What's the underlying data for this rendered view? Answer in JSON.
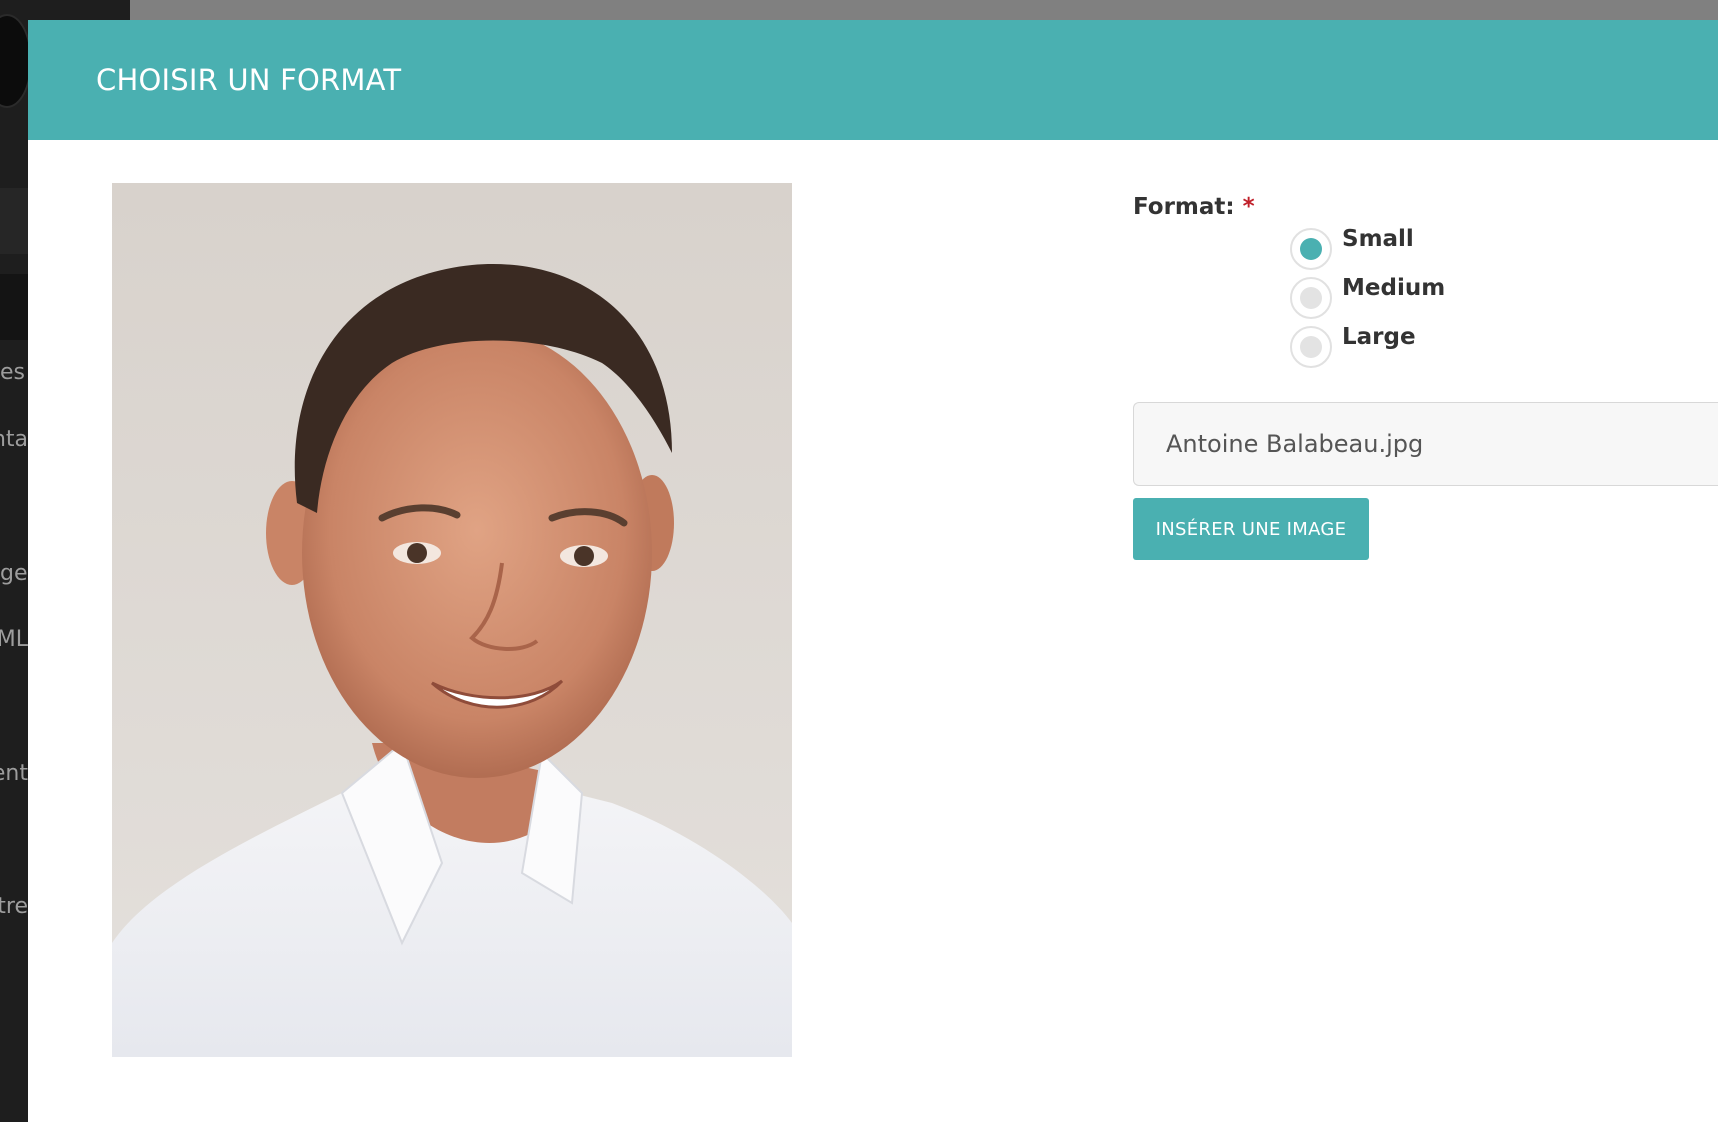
{
  "backdrop": {
    "sidebar_labels": [
      "es",
      "nta",
      "ge",
      "ML",
      "ent",
      "tre"
    ]
  },
  "modal": {
    "title": "CHOISIR UN FORMAT",
    "header_color": "#4ab0b1"
  },
  "preview": {
    "alt": "Antoine Balabeau.jpg"
  },
  "form": {
    "format_label": "Format:",
    "required_mark": "*",
    "options": [
      {
        "label": "Small",
        "checked": true
      },
      {
        "label": "Medium",
        "checked": false
      },
      {
        "label": "Large",
        "checked": false
      }
    ],
    "filename_value": "Antoine Balabeau.jpg",
    "insert_button_label": "INSÉRER UNE IMAGE"
  },
  "colors": {
    "accent": "#4ab0b1",
    "required": "#c0202a"
  }
}
